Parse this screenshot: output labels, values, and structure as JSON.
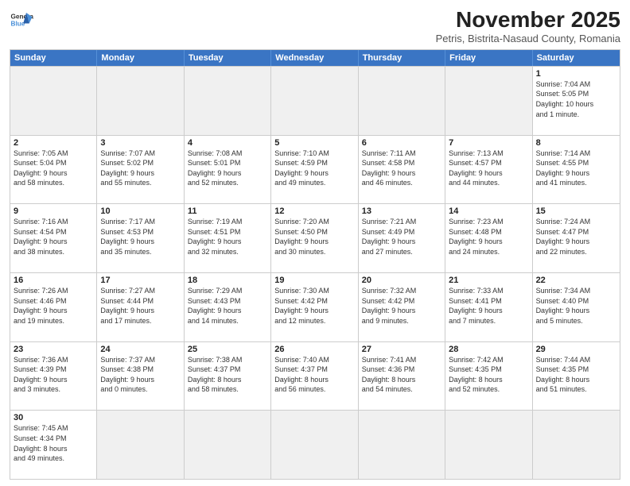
{
  "header": {
    "logo_general": "General",
    "logo_blue": "Blue",
    "month_title": "November 2025",
    "subtitle": "Petris, Bistrita-Nasaud County, Romania"
  },
  "weekdays": [
    "Sunday",
    "Monday",
    "Tuesday",
    "Wednesday",
    "Thursday",
    "Friday",
    "Saturday"
  ],
  "rows": [
    [
      {
        "day": "",
        "text": ""
      },
      {
        "day": "",
        "text": ""
      },
      {
        "day": "",
        "text": ""
      },
      {
        "day": "",
        "text": ""
      },
      {
        "day": "",
        "text": ""
      },
      {
        "day": "",
        "text": ""
      },
      {
        "day": "1",
        "text": "Sunrise: 7:04 AM\nSunset: 5:05 PM\nDaylight: 10 hours\nand 1 minute."
      }
    ],
    [
      {
        "day": "2",
        "text": "Sunrise: 7:05 AM\nSunset: 5:04 PM\nDaylight: 9 hours\nand 58 minutes."
      },
      {
        "day": "3",
        "text": "Sunrise: 7:07 AM\nSunset: 5:02 PM\nDaylight: 9 hours\nand 55 minutes."
      },
      {
        "day": "4",
        "text": "Sunrise: 7:08 AM\nSunset: 5:01 PM\nDaylight: 9 hours\nand 52 minutes."
      },
      {
        "day": "5",
        "text": "Sunrise: 7:10 AM\nSunset: 4:59 PM\nDaylight: 9 hours\nand 49 minutes."
      },
      {
        "day": "6",
        "text": "Sunrise: 7:11 AM\nSunset: 4:58 PM\nDaylight: 9 hours\nand 46 minutes."
      },
      {
        "day": "7",
        "text": "Sunrise: 7:13 AM\nSunset: 4:57 PM\nDaylight: 9 hours\nand 44 minutes."
      },
      {
        "day": "8",
        "text": "Sunrise: 7:14 AM\nSunset: 4:55 PM\nDaylight: 9 hours\nand 41 minutes."
      }
    ],
    [
      {
        "day": "9",
        "text": "Sunrise: 7:16 AM\nSunset: 4:54 PM\nDaylight: 9 hours\nand 38 minutes."
      },
      {
        "day": "10",
        "text": "Sunrise: 7:17 AM\nSunset: 4:53 PM\nDaylight: 9 hours\nand 35 minutes."
      },
      {
        "day": "11",
        "text": "Sunrise: 7:19 AM\nSunset: 4:51 PM\nDaylight: 9 hours\nand 32 minutes."
      },
      {
        "day": "12",
        "text": "Sunrise: 7:20 AM\nSunset: 4:50 PM\nDaylight: 9 hours\nand 30 minutes."
      },
      {
        "day": "13",
        "text": "Sunrise: 7:21 AM\nSunset: 4:49 PM\nDaylight: 9 hours\nand 27 minutes."
      },
      {
        "day": "14",
        "text": "Sunrise: 7:23 AM\nSunset: 4:48 PM\nDaylight: 9 hours\nand 24 minutes."
      },
      {
        "day": "15",
        "text": "Sunrise: 7:24 AM\nSunset: 4:47 PM\nDaylight: 9 hours\nand 22 minutes."
      }
    ],
    [
      {
        "day": "16",
        "text": "Sunrise: 7:26 AM\nSunset: 4:46 PM\nDaylight: 9 hours\nand 19 minutes."
      },
      {
        "day": "17",
        "text": "Sunrise: 7:27 AM\nSunset: 4:44 PM\nDaylight: 9 hours\nand 17 minutes."
      },
      {
        "day": "18",
        "text": "Sunrise: 7:29 AM\nSunset: 4:43 PM\nDaylight: 9 hours\nand 14 minutes."
      },
      {
        "day": "19",
        "text": "Sunrise: 7:30 AM\nSunset: 4:42 PM\nDaylight: 9 hours\nand 12 minutes."
      },
      {
        "day": "20",
        "text": "Sunrise: 7:32 AM\nSunset: 4:42 PM\nDaylight: 9 hours\nand 9 minutes."
      },
      {
        "day": "21",
        "text": "Sunrise: 7:33 AM\nSunset: 4:41 PM\nDaylight: 9 hours\nand 7 minutes."
      },
      {
        "day": "22",
        "text": "Sunrise: 7:34 AM\nSunset: 4:40 PM\nDaylight: 9 hours\nand 5 minutes."
      }
    ],
    [
      {
        "day": "23",
        "text": "Sunrise: 7:36 AM\nSunset: 4:39 PM\nDaylight: 9 hours\nand 3 minutes."
      },
      {
        "day": "24",
        "text": "Sunrise: 7:37 AM\nSunset: 4:38 PM\nDaylight: 9 hours\nand 0 minutes."
      },
      {
        "day": "25",
        "text": "Sunrise: 7:38 AM\nSunset: 4:37 PM\nDaylight: 8 hours\nand 58 minutes."
      },
      {
        "day": "26",
        "text": "Sunrise: 7:40 AM\nSunset: 4:37 PM\nDaylight: 8 hours\nand 56 minutes."
      },
      {
        "day": "27",
        "text": "Sunrise: 7:41 AM\nSunset: 4:36 PM\nDaylight: 8 hours\nand 54 minutes."
      },
      {
        "day": "28",
        "text": "Sunrise: 7:42 AM\nSunset: 4:35 PM\nDaylight: 8 hours\nand 52 minutes."
      },
      {
        "day": "29",
        "text": "Sunrise: 7:44 AM\nSunset: 4:35 PM\nDaylight: 8 hours\nand 51 minutes."
      }
    ],
    [
      {
        "day": "30",
        "text": "Sunrise: 7:45 AM\nSunset: 4:34 PM\nDaylight: 8 hours\nand 49 minutes."
      },
      {
        "day": "",
        "text": ""
      },
      {
        "day": "",
        "text": ""
      },
      {
        "day": "",
        "text": ""
      },
      {
        "day": "",
        "text": ""
      },
      {
        "day": "",
        "text": ""
      },
      {
        "day": "",
        "text": ""
      }
    ]
  ]
}
